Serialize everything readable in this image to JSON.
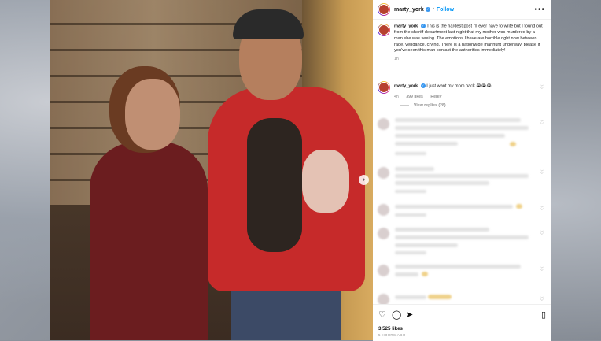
{
  "header": {
    "username": "marty_york",
    "verified": true,
    "separator": "•",
    "follow_label": "Follow",
    "more_icon": "more-horizontal-icon"
  },
  "caption": {
    "username": "marty_york",
    "text": "This is the hardest post I'll ever have to write but I found out from the sheriff department last night that my mother was murdered by a man she was seeing. The emotions I have are horrible right now between rage, vengance, crying. There is a nationwide manhunt underway, please if you've seen this man contact the authorities immediately!",
    "time": "1h"
  },
  "reply": {
    "username": "marty_york",
    "text": "I just want my mom back 😭😭😭",
    "time": "4h",
    "likes": "399 likes",
    "reply_label": "Reply",
    "view_replies": "View replies (28)"
  },
  "media": {
    "next_button": "›"
  },
  "footer": {
    "likes": "3,525 likes",
    "time_ago": "5 HOURS AGO"
  },
  "colors": {
    "accent": "#0095f6",
    "verified": "#3897f0"
  }
}
